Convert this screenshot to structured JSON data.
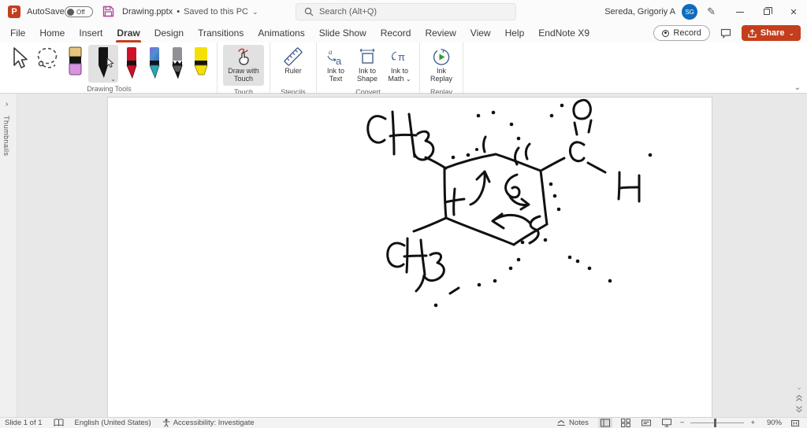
{
  "titlebar": {
    "app": "PowerPoint",
    "autosave_label": "AutoSave",
    "autosave_state": "Off",
    "filename": "Drawing.pptx",
    "save_status": "Saved to this PC",
    "search_placeholder": "Search (Alt+Q)",
    "user_name": "Sereda, Grigoriy A",
    "user_initials": "SG"
  },
  "ribbon": {
    "tabs": [
      "File",
      "Home",
      "Insert",
      "Draw",
      "Design",
      "Transitions",
      "Animations",
      "Slide Show",
      "Record",
      "Review",
      "View",
      "Help",
      "EndNote X9"
    ],
    "active_tab": "Draw",
    "record_label": "Record",
    "share_label": "Share",
    "groups": {
      "drawing_tools": {
        "label": "Drawing Tools",
        "tools": [
          "select",
          "lasso-select",
          "eraser",
          "black-pen",
          "red-pen",
          "galaxy-pen",
          "pencil",
          "yellow-highlighter"
        ],
        "selected_tool": "black-pen"
      },
      "touch": {
        "label": "Touch",
        "button_label": "Draw with Touch",
        "selected": true
      },
      "stencils": {
        "label": "Stencils",
        "button_label": "Ruler"
      },
      "convert": {
        "label": "Convert",
        "buttons": [
          "Ink to Text",
          "Ink to Shape",
          "Ink to Math"
        ]
      },
      "replay": {
        "label": "Replay",
        "button_label": "Ink Replay"
      }
    }
  },
  "thumbnails_pane": {
    "label": "Thumbnails"
  },
  "slide": {
    "ink_text_labels": [
      "CH3",
      "CH3",
      "O",
      "C",
      "H"
    ],
    "ink_color": "#111111",
    "content_description": "Hand-drawn dimethyl-cyclohexene ring with CHO aldehyde group, curved reaction arrows and electron dots"
  },
  "statusbar": {
    "slide_indicator": "Slide 1 of 1",
    "language": "English (United States)",
    "accessibility": "Accessibility: Investigate",
    "notes_label": "Notes",
    "zoom_out": "−",
    "zoom_in": "+",
    "zoom_level": "90%"
  },
  "icons": {
    "bullet": "•",
    "chevron_down": "⌄",
    "chevron_right": "›",
    "close": "✕",
    "draft_pen": "✎"
  },
  "colors": {
    "accent": "#c43e1c",
    "share_button": "#c43e1c",
    "avatar": "#0f6cbd",
    "selected_tool_bg": "#e1e1e1"
  }
}
